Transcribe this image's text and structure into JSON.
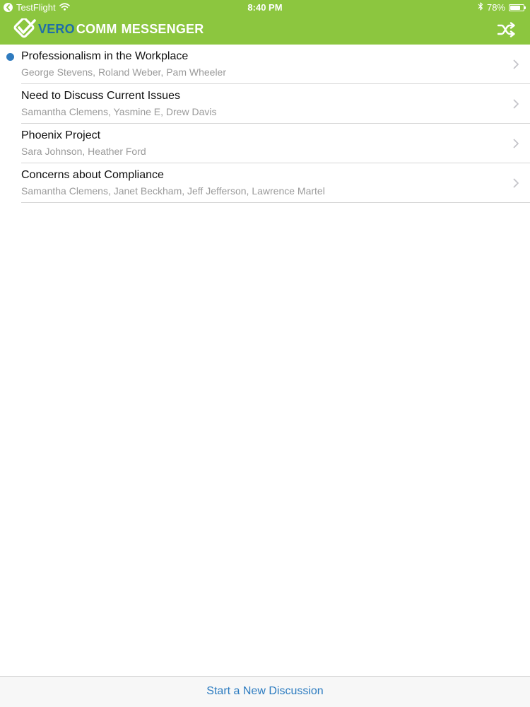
{
  "status_bar": {
    "back_app": "TestFlight",
    "time": "8:40 PM",
    "battery_text": "78%",
    "battery_level": 0.78
  },
  "header": {
    "logo_part1": "VERO",
    "logo_part2": "COMM",
    "logo_part3": "MESSENGER",
    "accent_color": "#8cc63f",
    "shuffle_icon": "shuffle-icon"
  },
  "discussions": [
    {
      "title": "Professionalism in the Workplace",
      "participants": "George Stevens, Roland Weber, Pam Wheeler",
      "unread": true
    },
    {
      "title": "Need to Discuss Current Issues",
      "participants": "Samantha Clemens, Yasmine E, Drew Davis",
      "unread": false
    },
    {
      "title": "Phoenix Project",
      "participants": "Sara Johnson, Heather Ford",
      "unread": false
    },
    {
      "title": "Concerns about Compliance",
      "participants": "Samantha Clemens, Janet Beckham, Jeff Jefferson, Lawrence Martel",
      "unread": false
    }
  ],
  "toolbar": {
    "new_discussion_label": "Start a New Discussion"
  }
}
